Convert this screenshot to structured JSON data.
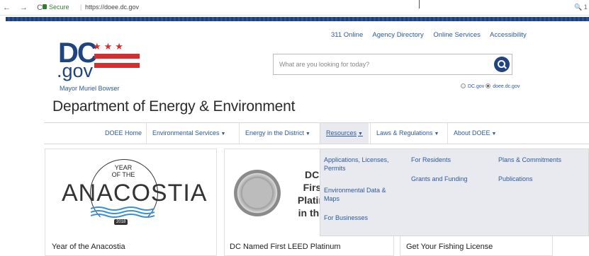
{
  "browser": {
    "nav_icons": "← → C",
    "secure_label": "Secure",
    "separator": "|",
    "url": "https://doee.dc.gov",
    "zoom_icon": "🔍 1"
  },
  "header": {
    "top_links": [
      "311 Online",
      "Agency Directory",
      "Online Services",
      "Accessibility"
    ],
    "logo_dc": "DC",
    "logo_gov": ".gov",
    "logo_stars": "★★★",
    "mayor": "Mayor Muriel Bowser",
    "search_placeholder": "What are you looking for today?",
    "radio_dcgov": "DC.gov",
    "radio_doee": "doee.dc.gov",
    "department": "Department of Energy & Environment"
  },
  "nav": {
    "items": [
      "DOEE Home",
      "Environmental Services",
      "Energy in the District",
      "Resources",
      "Laws & Regulations",
      "About DOEE"
    ],
    "caret": "▼"
  },
  "dropdown": {
    "col1": [
      "Applications, Licenses, Permits",
      "Environmental Data & Maps",
      "For Businesses"
    ],
    "col2": [
      "For Residents",
      "Grants and Funding"
    ],
    "col3": [
      "Plans & Commitments",
      "Publications"
    ]
  },
  "cards": {
    "anacostia_year_of": "YEAR OF THE",
    "anacostia_word": "ANACOSTIA",
    "anacostia_year": "2018",
    "anacostia_title": "Year of the Anacostia",
    "leed_text": "DC I First Platin in the",
    "leed_title": "DC Named First LEED Platinum",
    "fishing_title": "Get Your Fishing License"
  },
  "colors": {
    "brand_blue": "#1f4480",
    "brand_red": "#d32f2f",
    "link_blue": "#2c5a9a"
  }
}
